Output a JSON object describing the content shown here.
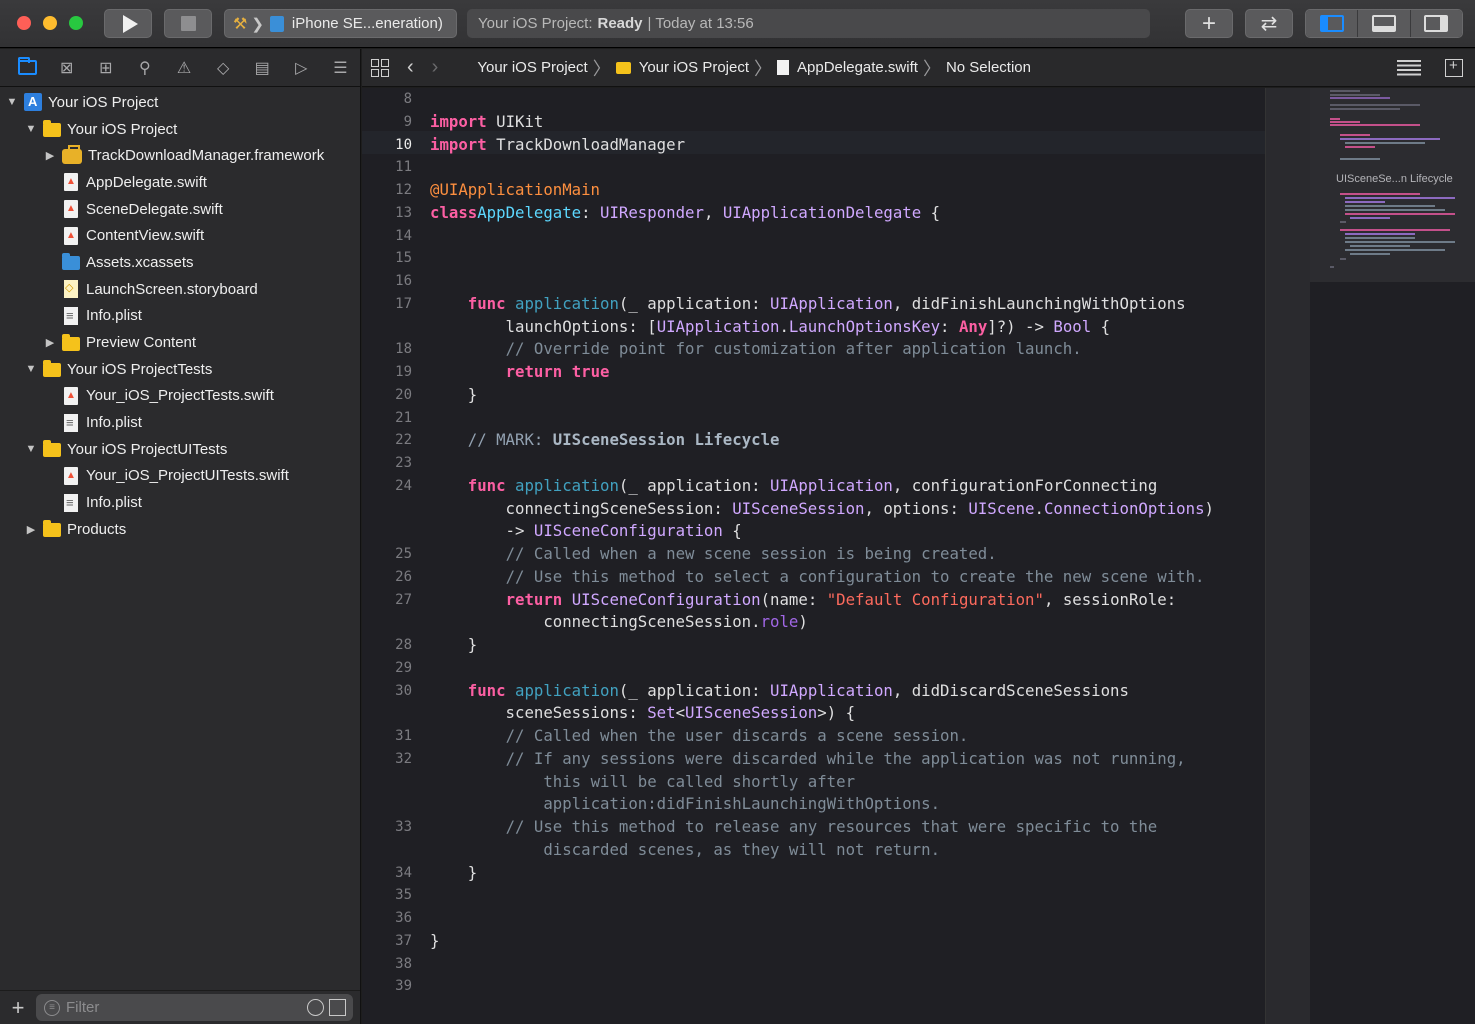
{
  "toolbar": {
    "scheme_sep": "❯",
    "device": "iPhone SE...eneration)",
    "status_project": "Your iOS Project:",
    "status_state": "Ready",
    "status_time": "| Today at 13:56",
    "colors": {
      "close": "#fe5f57",
      "minimize": "#febc2e",
      "zoom": "#28c840",
      "accent": "#1a8cff"
    }
  },
  "navigator": {
    "tabs": [
      "folder-icon",
      "xmark-box-icon",
      "hierarchy-icon",
      "search-icon",
      "warning-icon",
      "test-diamond-icon",
      "debug-gauge-icon",
      "breakpoint-icon",
      "report-icon"
    ],
    "tree": [
      {
        "label": "Your iOS Project",
        "depth": 0,
        "disclosure": "▼",
        "icon": "project"
      },
      {
        "label": "Your iOS Project",
        "depth": 1,
        "disclosure": "▼",
        "icon": "folder"
      },
      {
        "label": "TrackDownloadManager.framework",
        "depth": 2,
        "disclosure": "▶",
        "icon": "framework"
      },
      {
        "label": "AppDelegate.swift",
        "depth": 2,
        "disclosure": "",
        "icon": "swift"
      },
      {
        "label": "SceneDelegate.swift",
        "depth": 2,
        "disclosure": "",
        "icon": "swift"
      },
      {
        "label": "ContentView.swift",
        "depth": 2,
        "disclosure": "",
        "icon": "swift"
      },
      {
        "label": "Assets.xcassets",
        "depth": 2,
        "disclosure": "",
        "icon": "folder-blue"
      },
      {
        "label": "LaunchScreen.storyboard",
        "depth": 2,
        "disclosure": "",
        "icon": "storyboard"
      },
      {
        "label": "Info.plist",
        "depth": 2,
        "disclosure": "",
        "icon": "plist"
      },
      {
        "label": "Preview Content",
        "depth": 2,
        "disclosure": "▶",
        "icon": "folder"
      },
      {
        "label": "Your iOS ProjectTests",
        "depth": 1,
        "disclosure": "▼",
        "icon": "folder"
      },
      {
        "label": "Your_iOS_ProjectTests.swift",
        "depth": 2,
        "disclosure": "",
        "icon": "swift"
      },
      {
        "label": "Info.plist",
        "depth": 2,
        "disclosure": "",
        "icon": "plist"
      },
      {
        "label": "Your iOS ProjectUITests",
        "depth": 1,
        "disclosure": "▼",
        "icon": "folder"
      },
      {
        "label": "Your_iOS_ProjectUITests.swift",
        "depth": 2,
        "disclosure": "",
        "icon": "swift"
      },
      {
        "label": "Info.plist",
        "depth": 2,
        "disclosure": "",
        "icon": "plist"
      },
      {
        "label": "Products",
        "depth": 1,
        "disclosure": "▶",
        "icon": "folder"
      }
    ],
    "filter_placeholder": "Filter"
  },
  "jumpbar": {
    "crumbs": [
      {
        "label": "Your iOS Project",
        "icon": "project"
      },
      {
        "label": "Your iOS Project",
        "icon": "folder"
      },
      {
        "label": "AppDelegate.swift",
        "icon": "swift"
      },
      {
        "label": "No Selection",
        "icon": ""
      }
    ],
    "sep": "〉"
  },
  "editor": {
    "current_line": 10,
    "lines": [
      {
        "n": "8",
        "t": []
      },
      {
        "n": "9",
        "t": [
          [
            "kw",
            "import"
          ],
          [
            "",
            "UIKit"
          ]
        ]
      },
      {
        "n": "10",
        "t": [
          [
            "kw",
            "import"
          ],
          [
            "",
            "TrackDownloadManager"
          ]
        ]
      },
      {
        "n": "11",
        "t": []
      },
      {
        "n": "12",
        "t": [
          [
            "at",
            "@UIApplicationMain"
          ]
        ]
      },
      {
        "n": "13",
        "t": [
          [
            "kw",
            "class"
          ],
          [
            "",
            "",
            ""
          ],
          [
            "tx",
            "AppDelegate"
          ],
          [
            "",
            ": "
          ],
          [
            "ty",
            "UIResponder"
          ],
          [
            "",
            ", "
          ],
          [
            "ty",
            "UIApplicationDelegate"
          ],
          [
            "",
            " {"
          ]
        ]
      },
      {
        "n": "14",
        "t": []
      },
      {
        "n": "15",
        "t": []
      },
      {
        "n": "16",
        "t": []
      },
      {
        "n": "17",
        "t": [
          [
            "",
            "    "
          ],
          [
            "kw",
            "func"
          ],
          [
            "",
            " "
          ],
          [
            "fn",
            "application"
          ],
          [
            "",
            "(_ application: "
          ],
          [
            "ty",
            "UIApplication"
          ],
          [
            "",
            ", didFinishLaunchingWithOptions"
          ]
        ]
      },
      {
        "n": "",
        "t": [
          [
            "",
            "        launchOptions: ["
          ],
          [
            "ty",
            "UIApplication"
          ],
          [
            "",
            "."
          ],
          [
            "ty",
            "LaunchOptionsKey"
          ],
          [
            "",
            ": "
          ],
          [
            "kw",
            "Any"
          ],
          [
            "",
            "]?) -> "
          ],
          [
            "ty",
            "Bool"
          ],
          [
            "",
            " {"
          ]
        ]
      },
      {
        "n": "18",
        "t": [
          [
            "",
            "        "
          ],
          [
            "cm",
            "// Override point for customization after application launch."
          ]
        ]
      },
      {
        "n": "19",
        "t": [
          [
            "",
            "        "
          ],
          [
            "kw",
            "return"
          ],
          [
            "",
            " "
          ],
          [
            "kw",
            "true"
          ]
        ]
      },
      {
        "n": "20",
        "t": [
          [
            "",
            "    }"
          ]
        ]
      },
      {
        "n": "21",
        "t": []
      },
      {
        "n": "22",
        "t": [
          [
            "",
            "    "
          ],
          [
            "mk",
            "// MARK: "
          ],
          [
            "mkb",
            "UISceneSession Lifecycle"
          ]
        ]
      },
      {
        "n": "23",
        "t": []
      },
      {
        "n": "24",
        "t": [
          [
            "",
            "    "
          ],
          [
            "kw",
            "func"
          ],
          [
            "",
            " "
          ],
          [
            "fn",
            "application"
          ],
          [
            "",
            "(_ application: "
          ],
          [
            "ty",
            "UIApplication"
          ],
          [
            "",
            ", configurationForConnecting"
          ]
        ]
      },
      {
        "n": "",
        "t": [
          [
            "",
            "        connectingSceneSession: "
          ],
          [
            "ty",
            "UISceneSession"
          ],
          [
            "",
            ", options: "
          ],
          [
            "ty",
            "UIScene"
          ],
          [
            "",
            "."
          ],
          [
            "ty",
            "ConnectionOptions"
          ],
          [
            "",
            ")"
          ]
        ]
      },
      {
        "n": "",
        "t": [
          [
            "",
            "        -> "
          ],
          [
            "ty",
            "UISceneConfiguration"
          ],
          [
            "",
            " {"
          ]
        ]
      },
      {
        "n": "25",
        "t": [
          [
            "",
            "        "
          ],
          [
            "cm",
            "// Called when a new scene session is being created."
          ]
        ]
      },
      {
        "n": "26",
        "t": [
          [
            "",
            "        "
          ],
          [
            "cm",
            "// Use this method to select a configuration to create the new scene with."
          ]
        ]
      },
      {
        "n": "27",
        "t": [
          [
            "",
            "        "
          ],
          [
            "kw",
            "return"
          ],
          [
            "",
            " "
          ],
          [
            "ty",
            "UISceneConfiguration"
          ],
          [
            "",
            "(name: "
          ],
          [
            "st",
            "\"Default Configuration\""
          ],
          [
            "",
            ", sessionRole:"
          ]
        ]
      },
      {
        "n": "",
        "t": [
          [
            "",
            "            connectingSceneSession."
          ],
          [
            "pr",
            "role"
          ],
          [
            "",
            ")"
          ]
        ]
      },
      {
        "n": "28",
        "t": [
          [
            "",
            "    }"
          ]
        ]
      },
      {
        "n": "29",
        "t": []
      },
      {
        "n": "30",
        "t": [
          [
            "",
            "    "
          ],
          [
            "kw",
            "func"
          ],
          [
            "",
            " "
          ],
          [
            "fn",
            "application"
          ],
          [
            "",
            "(_ application: "
          ],
          [
            "ty",
            "UIApplication"
          ],
          [
            "",
            ", didDiscardSceneSessions"
          ]
        ]
      },
      {
        "n": "",
        "t": [
          [
            "",
            "        sceneSessions: "
          ],
          [
            "ty",
            "Set"
          ],
          [
            "",
            "<"
          ],
          [
            "ty",
            "UISceneSession"
          ],
          [
            "",
            ">) {"
          ]
        ]
      },
      {
        "n": "31",
        "t": [
          [
            "",
            "        "
          ],
          [
            "cm",
            "// Called when the user discards a scene session."
          ]
        ]
      },
      {
        "n": "32",
        "t": [
          [
            "",
            "        "
          ],
          [
            "cm",
            "// If any sessions were discarded while the application was not running,"
          ]
        ]
      },
      {
        "n": "",
        "t": [
          [
            "",
            "            "
          ],
          [
            "cm",
            "this will be called shortly after"
          ]
        ]
      },
      {
        "n": "",
        "t": [
          [
            "",
            "            "
          ],
          [
            "cm",
            "application:didFinishLaunchingWithOptions."
          ]
        ]
      },
      {
        "n": "33",
        "t": [
          [
            "",
            "        "
          ],
          [
            "cm",
            "// Use this method to release any resources that were specific to the"
          ]
        ]
      },
      {
        "n": "",
        "t": [
          [
            "",
            "            "
          ],
          [
            "cm",
            "discarded scenes, as they will not return."
          ]
        ]
      },
      {
        "n": "34",
        "t": [
          [
            "",
            "    }"
          ]
        ]
      },
      {
        "n": "35",
        "t": []
      },
      {
        "n": "36",
        "t": []
      },
      {
        "n": "37",
        "t": [
          [
            "",
            "}"
          ]
        ]
      },
      {
        "n": "38",
        "t": []
      },
      {
        "n": "39",
        "t": []
      }
    ]
  },
  "minimap": {
    "mark_label": "UISceneSe...n Lifecycle"
  }
}
